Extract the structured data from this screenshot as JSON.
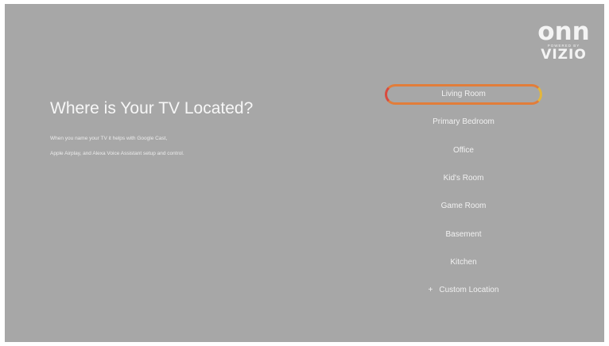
{
  "brand": {
    "logo_main": "onn",
    "logo_sub": "POWERED BY",
    "logo_brand": "VIZIO"
  },
  "header": {
    "title": "Where is Your TV Located?",
    "description_line1": "When you name your TV it helps with Google Cast,",
    "description_line2": "Apple Airplay, and Alexa Voice Assistant setup and control."
  },
  "locations": {
    "items": [
      {
        "label": "Living Room",
        "selected": true
      },
      {
        "label": "Primary Bedroom"
      },
      {
        "label": "Office"
      },
      {
        "label": "Kid's Room"
      },
      {
        "label": "Game Room"
      },
      {
        "label": "Basement"
      },
      {
        "label": "Kitchen"
      },
      {
        "label": "Custom Location",
        "icon": "plus-icon"
      }
    ]
  },
  "colors": {
    "background": "#a7a7a7",
    "focus_ring": "#e27d3a",
    "text": "#f7f7f7"
  }
}
